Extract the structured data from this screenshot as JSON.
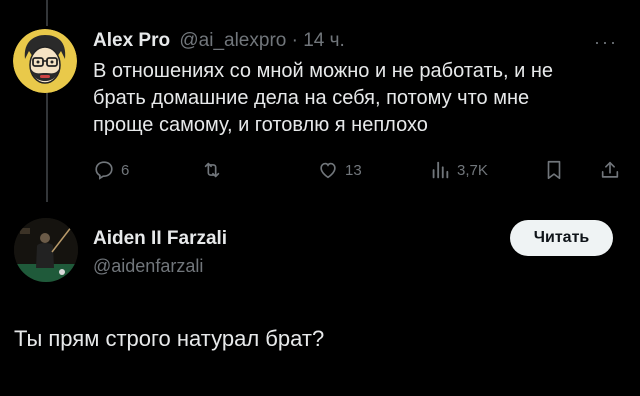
{
  "tweet": {
    "author_name": "Alex Pro",
    "handle": "@ai_alexpro",
    "separator": " · ",
    "time": "14 ч.",
    "more_icon": "more-dots-icon",
    "lines": [
      "В отношениях со мной можно и не работать, и не",
      "брать домашние дела на себя, потому что мне",
      "проще самому, и готовлю я неплохо"
    ],
    "actions": {
      "reply_count": "6",
      "retweet_count": "",
      "like_count": "13",
      "views_count": "3,7K"
    }
  },
  "reply": {
    "author_name": "Aiden II Farzali",
    "handle": "@aidenfarzali",
    "follow_label": "Читать",
    "text": "Ты прям строго натурал брат?"
  },
  "colors": {
    "background": "#000000",
    "text": "#e7e9ea",
    "muted": "#71767b",
    "button_bg": "#eff3f4"
  }
}
